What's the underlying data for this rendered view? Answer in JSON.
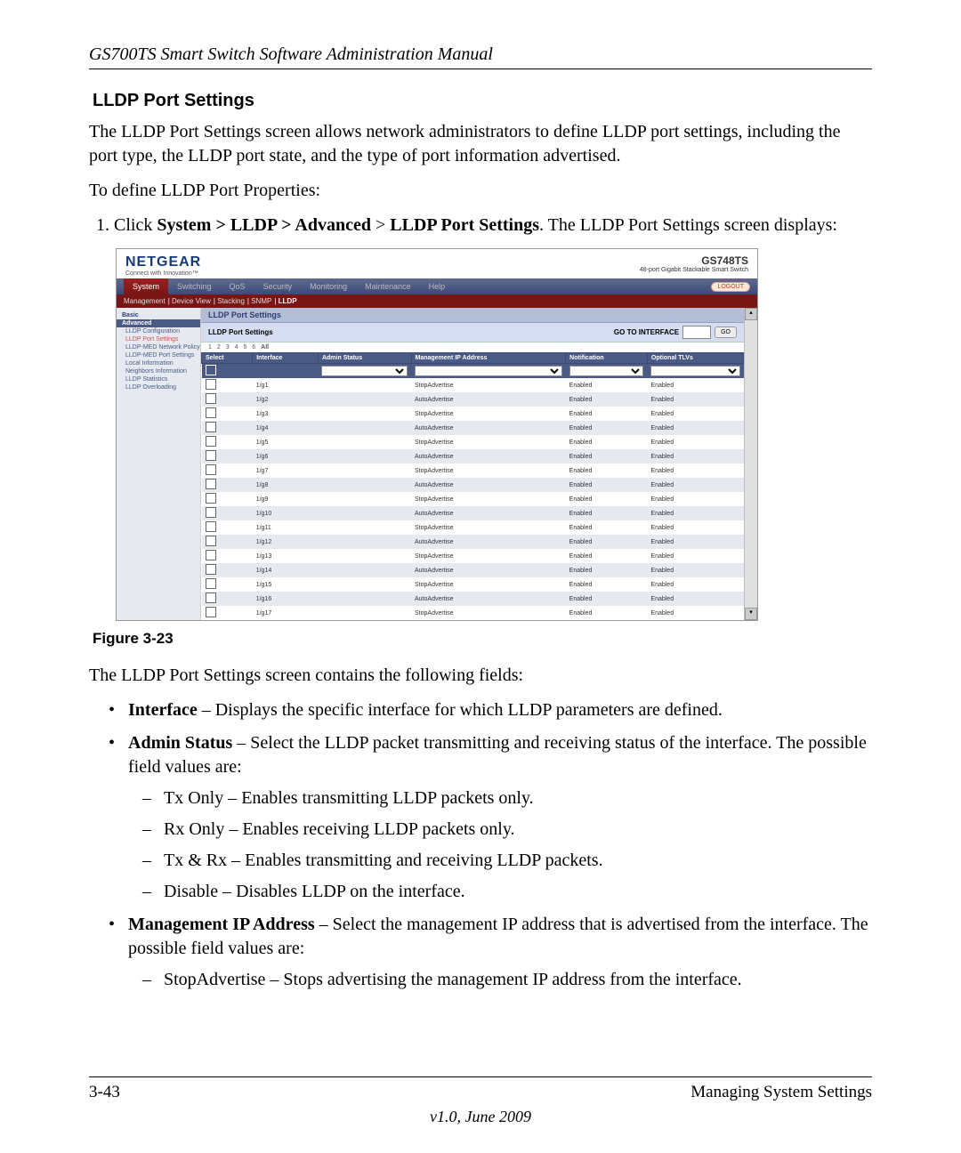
{
  "doc_header": "GS700TS Smart Switch Software Administration Manual",
  "section_title": "LLDP Port Settings",
  "intro_para": "The LLDP Port Settings screen allows network administrators to define LLDP port settings, including the port type, the LLDP port state, and the type of port information advertised.",
  "lead_in": "To define LLDP Port Properties:",
  "step1_prefix": "Click ",
  "step1_path": "System > LLDP > Advanced",
  "step1_gt": " > ",
  "step1_target": "LLDP Port Settings",
  "step1_suffix": ". The LLDP Port Settings screen displays:",
  "figure_caption": "Figure 3-23",
  "after_fig": "The LLDP Port Settings screen contains the following fields:",
  "f_interface_bold": "Interface",
  "f_interface_rest": " – Displays the specific interface for which LLDP parameters are defined.",
  "f_admin_bold": "Admin Status",
  "f_admin_rest": " – Select the LLDP packet transmitting and receiving status of the interface. The possible field values are:",
  "admin_opts": [
    "Tx Only – Enables transmitting LLDP packets only.",
    "Rx Only – Enables receiving LLDP packets only.",
    "Tx & Rx – Enables transmitting and receiving LLDP packets.",
    "Disable – Disables LLDP on the interface."
  ],
  "f_mip_bold": "Management IP Address",
  "f_mip_rest": " – Select the management IP address that is advertised from the interface. The possible field values are:",
  "mip_opts": [
    "StopAdvertise – Stops advertising the management IP address from the interface."
  ],
  "footer_left": "3-43",
  "footer_right": "Managing System Settings",
  "footer_version": "v1.0, June 2009",
  "shot": {
    "brand": "NETGEAR",
    "tagline": "Connect with Innovation™",
    "model_line1": "GS748TS",
    "model_line2": "48-port Gigabit Stackable Smart Switch",
    "nav": [
      "System",
      "Switching",
      "QoS",
      "Security",
      "Monitoring",
      "Maintenance",
      "Help"
    ],
    "logout": "LOGOUT",
    "subnav": [
      "Management",
      "Device View",
      "Stacking",
      "SNMP",
      "LLDP"
    ],
    "sidebar": {
      "basic": "Basic",
      "advanced": "Advanced",
      "items": [
        "LLDP Configuration",
        "LLDP Port Settings",
        "LLDP-MED Network Policy",
        "LLDP-MED Port Settings",
        "Local Information",
        "Neighbors Information",
        "LLDP Statistics",
        "LLDP Overloading"
      ]
    },
    "panel_title": "LLDP Port Settings",
    "sub_title": "LLDP Port Settings",
    "pager": [
      "1",
      "2",
      "3",
      "4",
      "5",
      "6",
      "All"
    ],
    "goto_label": "GO TO INTERFACE",
    "go_btn": "GO",
    "columns": [
      "Select",
      "Interface",
      "Admin Status",
      "Management IP Address",
      "Notification",
      "Optional TLVs"
    ],
    "rows": [
      {
        "if": "1/g1",
        "mip": "StopAdvertise",
        "not": "Enabled",
        "tlv": "Enabled",
        "alt": false
      },
      {
        "if": "1/g2",
        "mip": "AutoAdvertise",
        "not": "Enabled",
        "tlv": "Enabled",
        "alt": true
      },
      {
        "if": "1/g3",
        "mip": "StopAdvertise",
        "not": "Enabled",
        "tlv": "Enabled",
        "alt": false
      },
      {
        "if": "1/g4",
        "mip": "AutoAdvertise",
        "not": "Enabled",
        "tlv": "Enabled",
        "alt": true
      },
      {
        "if": "1/g5",
        "mip": "StopAdvertise",
        "not": "Enabled",
        "tlv": "Enabled",
        "alt": false
      },
      {
        "if": "1/g6",
        "mip": "AutoAdvertise",
        "not": "Enabled",
        "tlv": "Enabled",
        "alt": true
      },
      {
        "if": "1/g7",
        "mip": "StopAdvertise",
        "not": "Enabled",
        "tlv": "Enabled",
        "alt": false
      },
      {
        "if": "1/g8",
        "mip": "AutoAdvertise",
        "not": "Enabled",
        "tlv": "Enabled",
        "alt": true
      },
      {
        "if": "1/g9",
        "mip": "StopAdvertise",
        "not": "Enabled",
        "tlv": "Enabled",
        "alt": false
      },
      {
        "if": "1/g10",
        "mip": "AutoAdvertise",
        "not": "Enabled",
        "tlv": "Enabled",
        "alt": true
      },
      {
        "if": "1/g11",
        "mip": "StopAdvertise",
        "not": "Enabled",
        "tlv": "Enabled",
        "alt": false
      },
      {
        "if": "1/g12",
        "mip": "AutoAdvertise",
        "not": "Enabled",
        "tlv": "Enabled",
        "alt": true
      },
      {
        "if": "1/g13",
        "mip": "StopAdvertise",
        "not": "Enabled",
        "tlv": "Enabled",
        "alt": false
      },
      {
        "if": "1/g14",
        "mip": "AutoAdvertise",
        "not": "Enabled",
        "tlv": "Enabled",
        "alt": true
      },
      {
        "if": "1/g15",
        "mip": "StopAdvertise",
        "not": "Enabled",
        "tlv": "Enabled",
        "alt": false
      },
      {
        "if": "1/g16",
        "mip": "AutoAdvertise",
        "not": "Enabled",
        "tlv": "Enabled",
        "alt": true
      },
      {
        "if": "1/g17",
        "mip": "StopAdvertise",
        "not": "Enabled",
        "tlv": "Enabled",
        "alt": false
      }
    ]
  }
}
